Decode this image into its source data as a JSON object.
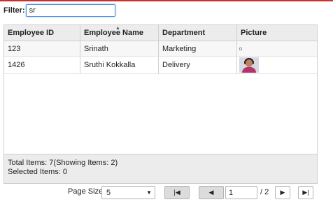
{
  "filter": {
    "label": "Filter:",
    "value": "sr"
  },
  "grid": {
    "columns": [
      "Employee ID",
      "Employee Name",
      "Department",
      "Picture"
    ],
    "rows": [
      {
        "id": "123",
        "name": "Srinath",
        "department": "Marketing",
        "picture": "broken-image"
      },
      {
        "id": "1426",
        "name": "Sruthi Kokkalla",
        "department": "Delivery",
        "picture": "employee-photo"
      }
    ]
  },
  "footer": {
    "total": "Total Items: 7(Showing Items: 2)",
    "selected": "Selected Items: 0"
  },
  "pager": {
    "page_size_label": "Page Size:",
    "page_size_value": "5",
    "first_icon": "|◀",
    "prev_icon": "◀",
    "current_page": "1",
    "total_pages": "/ 2",
    "next_icon": "▶",
    "last_icon": "▶|"
  },
  "colors": {
    "accent": "#4a90e2",
    "top_rule": "#c9302c",
    "header_bg": "#ececec"
  }
}
